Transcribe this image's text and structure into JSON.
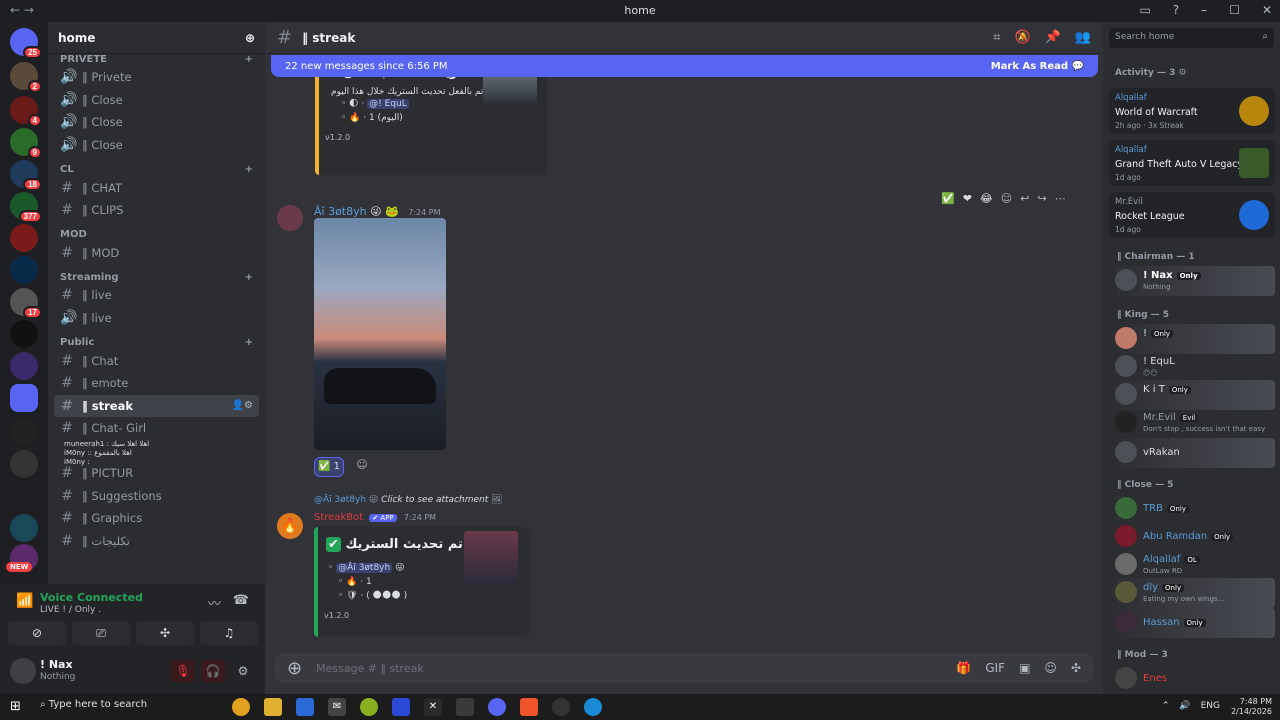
{
  "window": {
    "title": "home",
    "nav": "← →",
    "controls": [
      "▭",
      "?",
      "–",
      "☐",
      "✕"
    ]
  },
  "servers": {
    "badges": [
      "25",
      "2",
      "4",
      "9",
      "18",
      "377",
      "17"
    ],
    "new_badge": "NEW"
  },
  "channels": {
    "guild_name": "home",
    "sections": {
      "privete_header": "PRIVETE",
      "cl_header": "CL",
      "mod_header": "MOD",
      "streaming_header": "Streaming",
      "public_header": "Public"
    },
    "items": {
      "privete": "Privete",
      "close1": "Close",
      "close2": "Close",
      "close3": "Close",
      "chat_cl": "CHAT",
      "clips": "CLIPS",
      "mod": "MOD",
      "live1": "live",
      "live2": "live",
      "chat": "Chat",
      "emote": "emote",
      "streak": "streak",
      "chat_girl": "Chat- Girl",
      "pictur": "PICTUR",
      "suggestions": "Suggestions",
      "graphics": "Graphics",
      "arabic": "تكليجات"
    },
    "voice_users": [
      "muneerah1 : اهلا اهلا سيك",
      "iM0ny :: اهلا بالمقموع",
      "iM0ny :"
    ]
  },
  "voice": {
    "title": "Voice Connected",
    "sub": "LIVE ! / Only ."
  },
  "user": {
    "name": "! Nax",
    "status": "Nothing"
  },
  "chat": {
    "channel_name": "streak",
    "new_messages": "22 new messages since 6:56 PM",
    "mark_read": "Mark As Read",
    "embed1": {
      "title": "الستريك مُحدث بالفعل •",
      "line1": "تم بالفعل تحديث الستريك خلال هذا اليوم",
      "mention": "@! EquL",
      "line3": "1 (اليوم)",
      "version": "v1.2.0"
    },
    "msg2": {
      "author": "Āĭ 3øt8yh",
      "time": "7:24 PM",
      "reaction_count": "1"
    },
    "msg3": {
      "reply_author": "@Āĭ 3øt8yh",
      "reply_text": "Click to see attachment",
      "author": "StreakBot",
      "app_tag": "APP",
      "time": "7:24 PM",
      "title": "تم تحديث الستريك •",
      "mention": "@Āĭ 3øt8yh",
      "line2": "1",
      "line3": "( 🌑🌑🌑 )",
      "version": "v1.2.0"
    },
    "input_placeholder": "Message # ‖ streak"
  },
  "members": {
    "search_placeholder": "Search home",
    "activity_header": "Activity — 3",
    "activities": [
      {
        "who": "Alqallaf",
        "game": "World of Warcraft",
        "meta": "2h ago  ·  3x Streak"
      },
      {
        "who": "Alqallaf",
        "game": "Grand Theft Auto V Legacy",
        "meta": "1d ago"
      },
      {
        "who": "Mr.Evil",
        "game": "Rocket League",
        "meta": "1d ago"
      }
    ],
    "roles": {
      "chairman": "‖ Chairman — 1",
      "king": "‖ King — 5",
      "close": "‖ Close — 5",
      "mod": "‖ Mod — 3"
    },
    "list": {
      "nax": {
        "name": "! Nax",
        "tag": "Only",
        "sub": "Nothing"
      },
      "k1": {
        "name": "!",
        "tag": "Only"
      },
      "k2": {
        "name": "! EquL",
        "sub": "😶😶"
      },
      "k3": {
        "name": "K i T",
        "tag": "Only"
      },
      "k4": {
        "name": "Mr.Evil",
        "tag": "Evil",
        "sub": "Don't stop , success isn't that easy"
      },
      "k5": {
        "name": "vRakan"
      },
      "c1": {
        "name": "TRB",
        "tag": "Only"
      },
      "c2": {
        "name": "Abu Ramdan",
        "tag": "Only"
      },
      "c3": {
        "name": "Alqallaf",
        "tag": "OL",
        "sub": "OutLaw RD"
      },
      "c4": {
        "name": "dly",
        "tag": "Only",
        "sub": "Eating my own wings..."
      },
      "c5": {
        "name": "Hassan",
        "tag": "Only"
      },
      "m1": {
        "name": "Enes"
      }
    }
  },
  "taskbar": {
    "search": "Type here to search",
    "lang": "ENG",
    "time": "7:48 PM",
    "date": "2/14/2026"
  }
}
